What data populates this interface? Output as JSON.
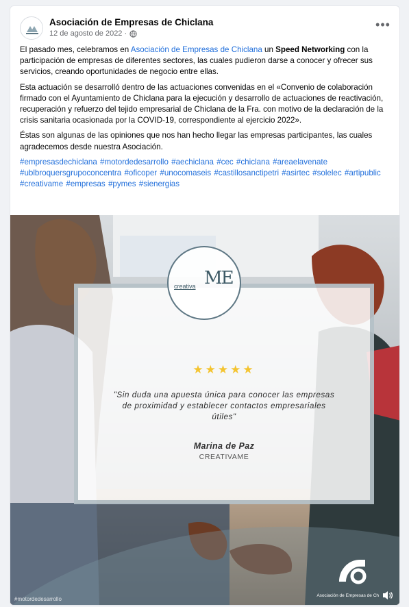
{
  "post": {
    "page_name": "Asociación de Empresas de Chiclana",
    "date": "12 de agosto de 2022 ·",
    "more_icon": "•••",
    "p1_a": "El pasado mes, celebramos en ",
    "p1_link": "Asociación de Empresas de Chiclana",
    "p1_b": " un ",
    "p1_bold": "Speed Networking",
    "p1_c": " con la participación de empresas de diferentes sectores, las cuales pudieron darse a conocer y ofrecer sus servicios, creando oportunidades de negocio entre ellas.",
    "p2": "Esta actuación se desarrolló dentro de las actuaciones convenidas en el «Convenio de colaboración firmado con el Ayuntamiento de Chiclana para la ejecución y desarrollo de actuaciones de reactivación, recuperación y refuerzo del tejido empresarial de Chiclana de la Fra. con motivo de la declaración de la crisis sanitaria ocasionada por la COVID-19, correspondiente al ejercicio 2022».",
    "p3": "Éstas son algunas de las opiniones que nos han hecho llegar las empresas participantes, las cuales agradecemos desde nuestra Asociación.",
    "hashtags": "#empresasdechiclana #motordedesarrollo #aechiclana #cec #chiclana #areaelavenate #ublbroquersgrupoconcentra #oficoper #unocomaseis #castillosanctipetri #asirtec #solelec #artipublic #creativame #empresas #pymes #sienergias"
  },
  "image": {
    "logo_text_left": "creativa",
    "logo_letters": "ME",
    "stars": "★★★★★",
    "quote": "\"Sin duda una apuesta única para conocer las empresas de proximidad y establecer contactos empresariales útiles\"",
    "author": "Marina de Paz",
    "company": "CREATIVAME",
    "watermark": "#motordedesarrollo",
    "brand_text": "Asociación de Empresas de Ch"
  },
  "colors": {
    "link": "#216fdb",
    "brand_teal": "#5e7784",
    "star": "#f4c430"
  }
}
